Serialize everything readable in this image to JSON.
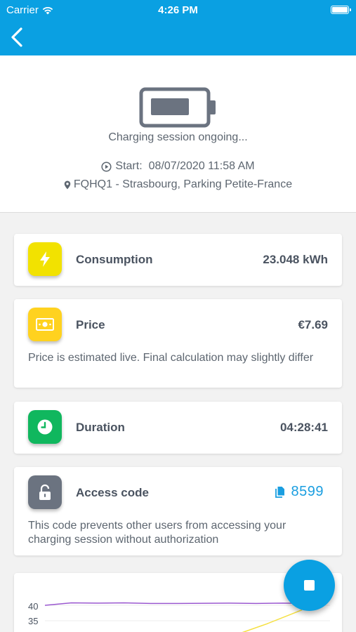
{
  "status_bar": {
    "carrier": "Carrier",
    "time": "4:26 PM"
  },
  "session": {
    "status": "Charging session ongoing...",
    "start_label": "Start:",
    "start_value": "08/07/2020 11:58 AM",
    "location": "FQHQ1 - Strasbourg, Parking Petite-France"
  },
  "cards": {
    "consumption": {
      "label": "Consumption",
      "value": "23.048 kWh",
      "icon": "lightning-icon",
      "color": "#f2e200"
    },
    "price": {
      "label": "Price",
      "value": "€7.69",
      "note": "Price is estimated live. Final calculation may slightly differ",
      "icon": "banknote-icon",
      "color": "#ffd21f"
    },
    "duration": {
      "label": "Duration",
      "value": "04:28:41",
      "icon": "clock-icon",
      "color": "#10b75e"
    },
    "access_code": {
      "label": "Access code",
      "value": "8599",
      "note": "This code prevents other users from accessing your charging session without authorization",
      "icon": "unlock-icon",
      "color": "#6b7380"
    }
  },
  "chart_data": {
    "type": "line",
    "y_ticks": [
      "40",
      "35"
    ],
    "series": [
      {
        "color": "#9b59d0",
        "values": [
          40.0,
          40.8,
          40.7,
          40.8,
          40.6,
          40.6,
          40.65,
          40.7,
          40.6,
          40.7,
          40.6
        ]
      },
      {
        "color": "#f5e040",
        "values": [
          30.0,
          34.0,
          38.5
        ]
      }
    ]
  },
  "fab": {
    "icon": "stop-icon"
  },
  "colors": {
    "primary": "#0aa0e2",
    "text": "#4a5360"
  }
}
